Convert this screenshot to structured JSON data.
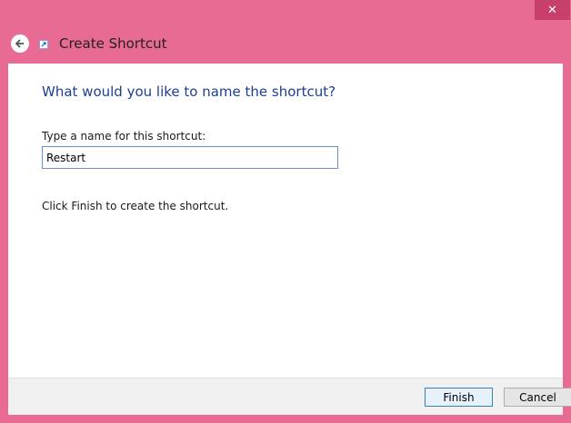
{
  "window": {
    "title": "Create Shortcut",
    "close_glyph": "✕"
  },
  "icons": {
    "back": "back-arrow-icon",
    "shortcut": "shortcut-icon",
    "close": "close-icon"
  },
  "main": {
    "heading": "What would you like to name the shortcut?",
    "name_label": "Type a name for this shortcut:",
    "name_value": "Restart",
    "info": "Click Finish to create the shortcut."
  },
  "footer": {
    "finish_label": "Finish",
    "cancel_label": "Cancel"
  },
  "colors": {
    "frame": "#e86b93",
    "close_button": "#c7406b",
    "heading": "#1c3f94",
    "input_border": "#6b8fc8",
    "footer": "#f0f0f0"
  }
}
